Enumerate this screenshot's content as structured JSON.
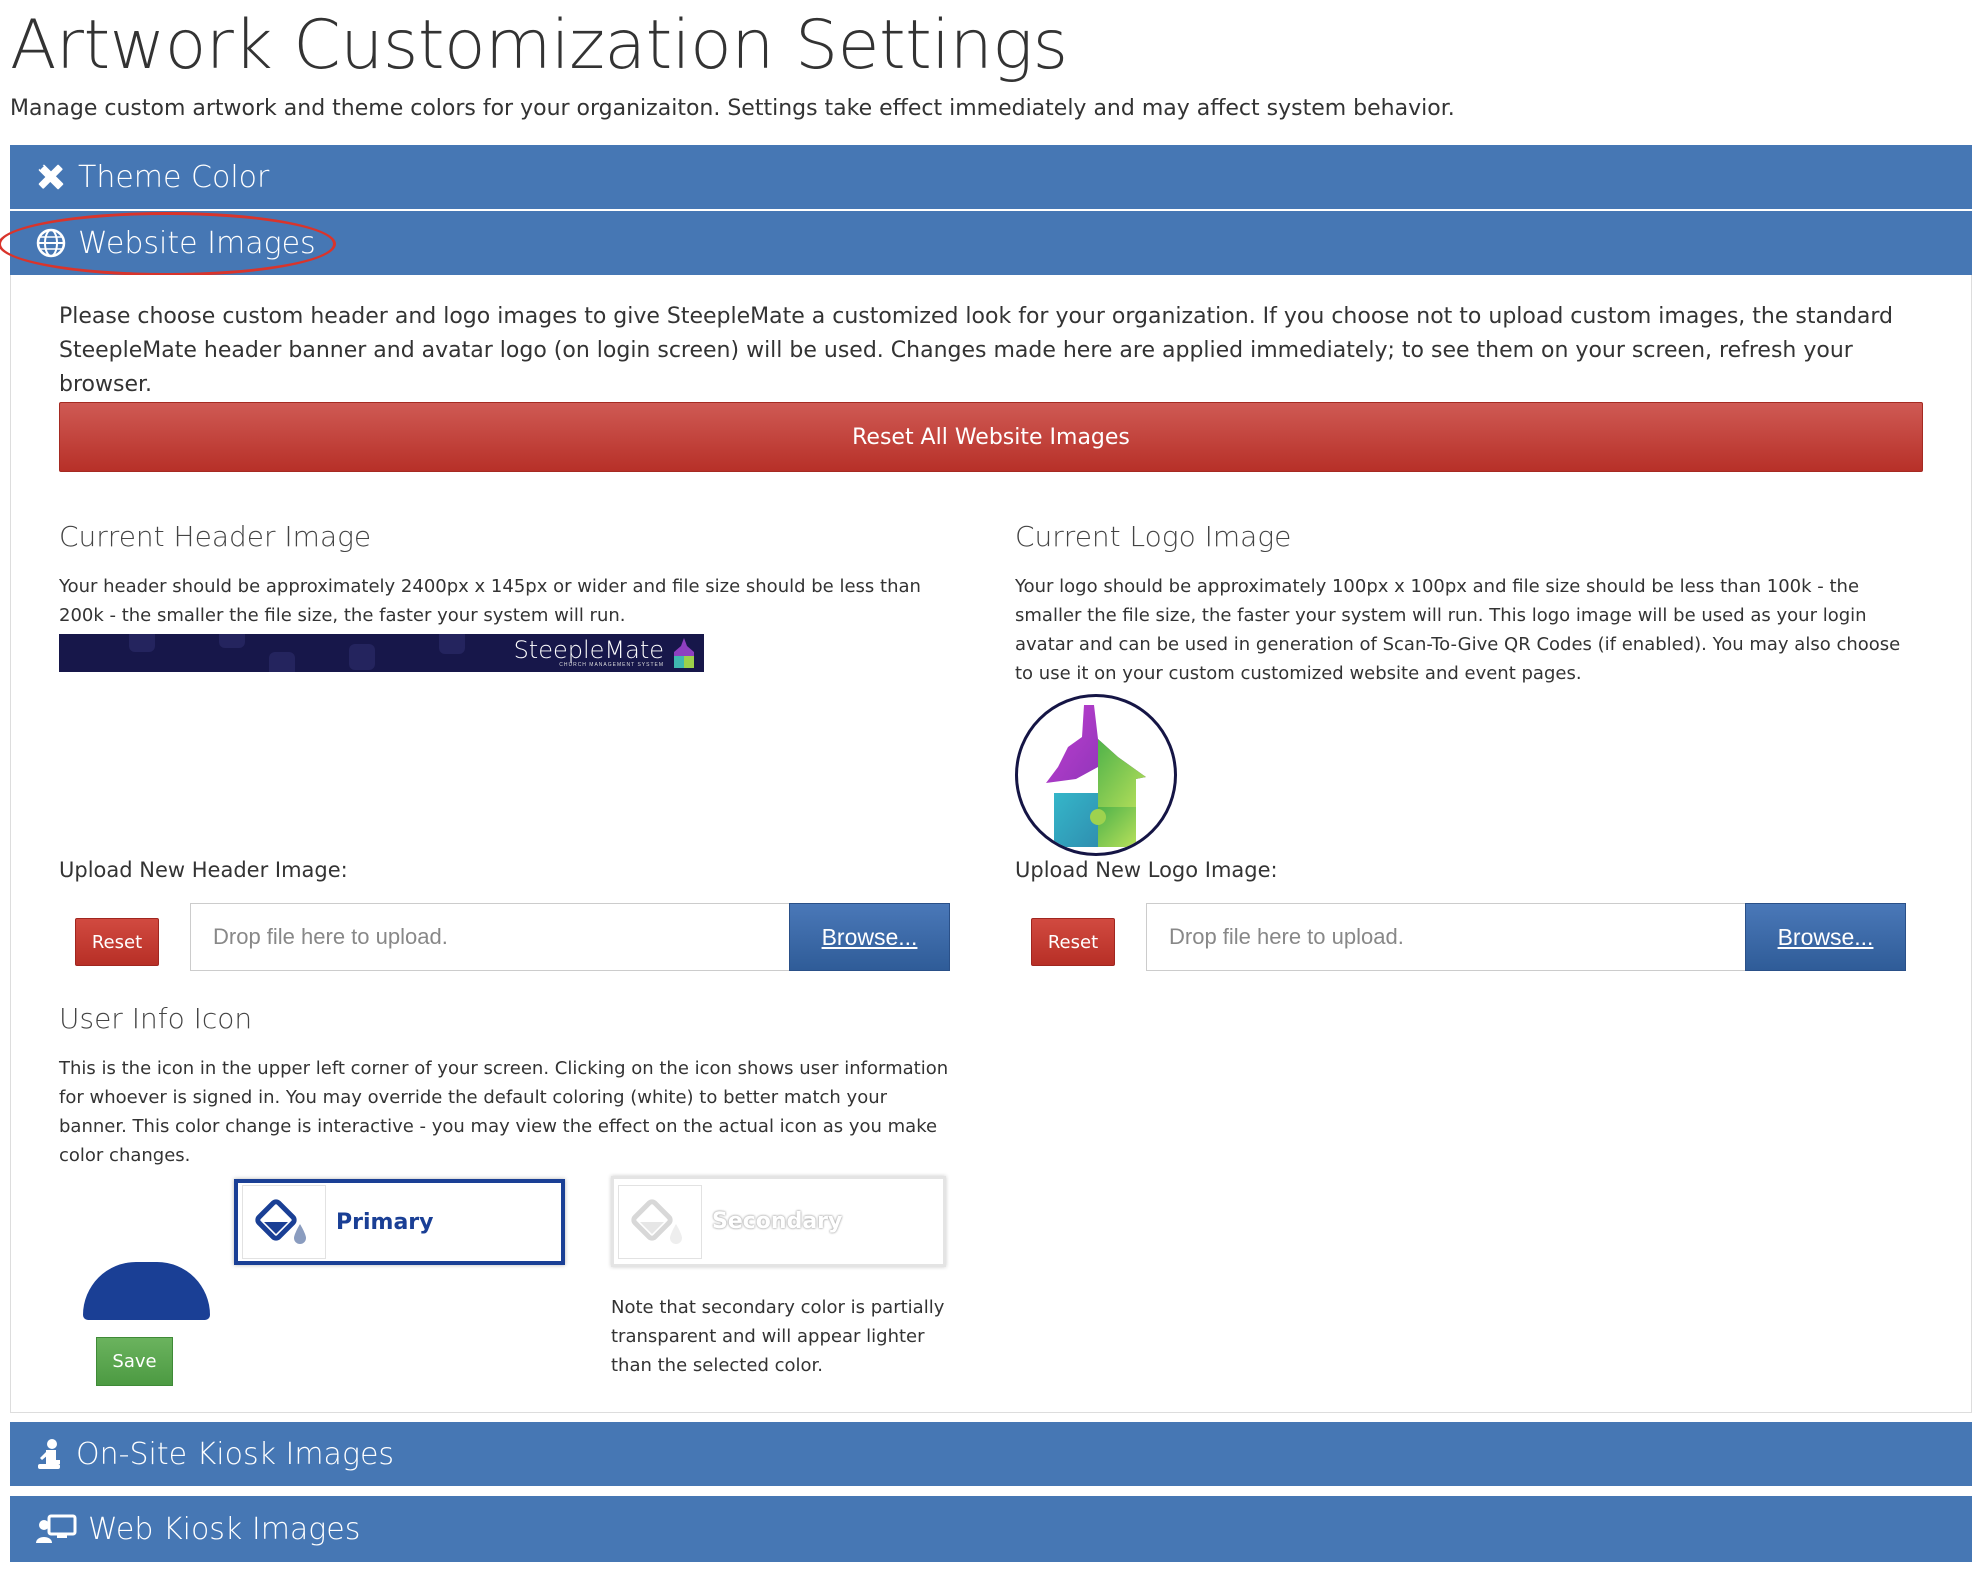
{
  "page": {
    "title": "Artwork Customization Settings",
    "description": "Manage custom artwork and theme colors for your organizaiton. Settings take effect immediately and may affect system behavior."
  },
  "panels": {
    "theme_color": "Theme Color",
    "website_images": "Website Images",
    "onsite_kiosk": "On-Site Kiosk Images",
    "web_kiosk": "Web Kiosk Images"
  },
  "website_images": {
    "intro": "Please choose custom header and logo images to give SteepleMate a customized look for your organization. If you choose not to upload custom images, the standard SteepleMate header banner and avatar logo (on login screen) will be used. Changes made here are applied immediately; to see them on your screen, refresh your browser.",
    "reset_all_label": "Reset All Website Images",
    "header": {
      "title": "Current Header Image",
      "text": "Your header should be approximately 2400px x 145px or wider and file size should be less than 200k - the smaller the file size, the faster your system will run.",
      "brand_text": "SteepleMate",
      "brand_subtext": "CHURCH MANAGEMENT SYSTEM",
      "upload_label": "Upload New Header Image:",
      "reset_label": "Reset",
      "drop_placeholder": "Drop file here to upload.",
      "browse_label": "Browse..."
    },
    "logo": {
      "title": "Current Logo Image",
      "text": "Your logo should be approximately 100px x 100px and file size should be less than 100k - the smaller the file size, the faster your system will run. This logo image will be used as your login avatar and can be used in generation of Scan-To-Give QR Codes (if enabled). You may also choose to use it on your custom customized website and event pages.",
      "upload_label": "Upload New Logo Image:",
      "reset_label": "Reset",
      "drop_placeholder": "Drop file here to upload.",
      "browse_label": "Browse..."
    },
    "user_info": {
      "title": "User Info Icon",
      "text": "This is the icon in the upper left corner of your screen. Clicking on the icon shows user information for whoever is signed in. You may override the default coloring (white) to better match your banner. This color change is interactive - you may view the effect on the actual icon as you make color changes.",
      "primary_label": "Primary",
      "secondary_label": "Secondary",
      "secondary_note": "Note that secondary color is partially transparent and will appear lighter than the selected color.",
      "save_label": "Save",
      "primary_color": "#1a3f95"
    }
  },
  "colors": {
    "panel_header": "#4677b4",
    "danger": "#c0392b",
    "success": "#5ca84f",
    "primary_blue": "#2f5c98",
    "highlight_oval": "#d9342b"
  },
  "icons": {
    "theme_color": "pencil-ruler-icon",
    "website_images": "globe-icon",
    "onsite_kiosk": "kneeling-person-icon",
    "web_kiosk": "user-monitor-icon",
    "swatch": "paint-bucket-icon"
  }
}
